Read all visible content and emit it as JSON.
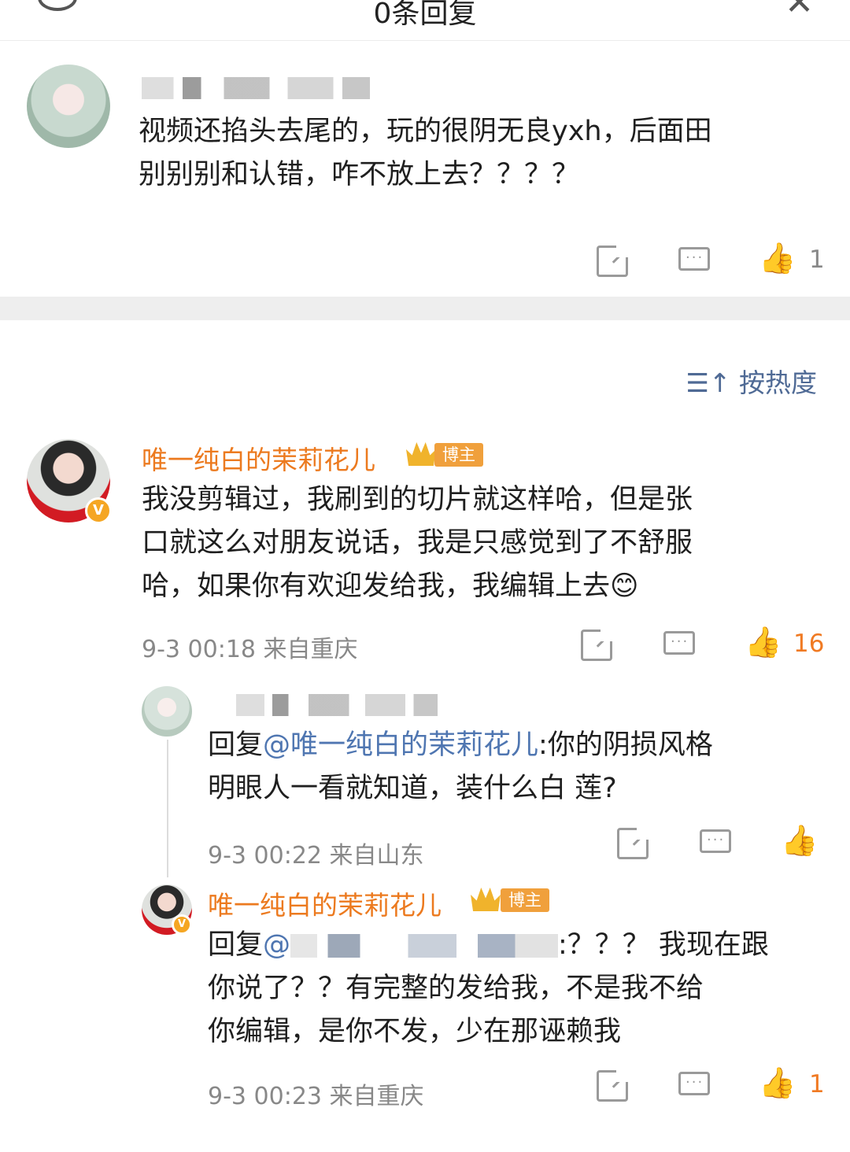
{
  "header": {
    "title": "0条回复",
    "back_icon": "back-circle-icon",
    "close_icon": "close-icon"
  },
  "original": {
    "text_line1": "视频还掐头去尾的，玩的很阴无良yxh，后面田",
    "text_line2": "别别别和认错，咋不放上去？？？？",
    "likes": "1"
  },
  "sort": {
    "icon": "sort-icon",
    "label": "按热度"
  },
  "comments": [
    {
      "author": "唯一纯白的茉莉花儿",
      "badge": "博主",
      "text_line1": "我没剪辑过，我刷到的切片就这样哈，但是张",
      "text_line2": "口就这么对朋友说话，我是只感觉到了不舒服",
      "text_line3": "哈，如果你有欢迎发给我，我编辑上去😊",
      "time": "9-3 00:18",
      "location": "来自重庆",
      "likes": "16",
      "liked": true
    },
    {
      "reply_prefix": "回复",
      "mention": "@唯一纯白的茉莉花儿",
      "text_after_mention": ":你的阴损风格",
      "text_line2": "明眼人一看就知道，装什么白 莲?",
      "time": "9-3 00:22",
      "location": "来自山东"
    },
    {
      "author": "唯一纯白的茉莉花儿",
      "badge": "博主",
      "reply_prefix": "回复",
      "mention_start": "@",
      "text_after_mention": ":？？？ 我现在跟",
      "text_line2": "你说了？？有完整的发给我，不是我不给",
      "text_line3": "你编辑，是你不发，少在那诬赖我",
      "time": "9-3 00:23",
      "location": "来自重庆",
      "likes": "1",
      "liked": true
    }
  ],
  "colors": {
    "accent": "#f07a23",
    "author": "#ec7a1f",
    "link": "#4f76b1"
  }
}
